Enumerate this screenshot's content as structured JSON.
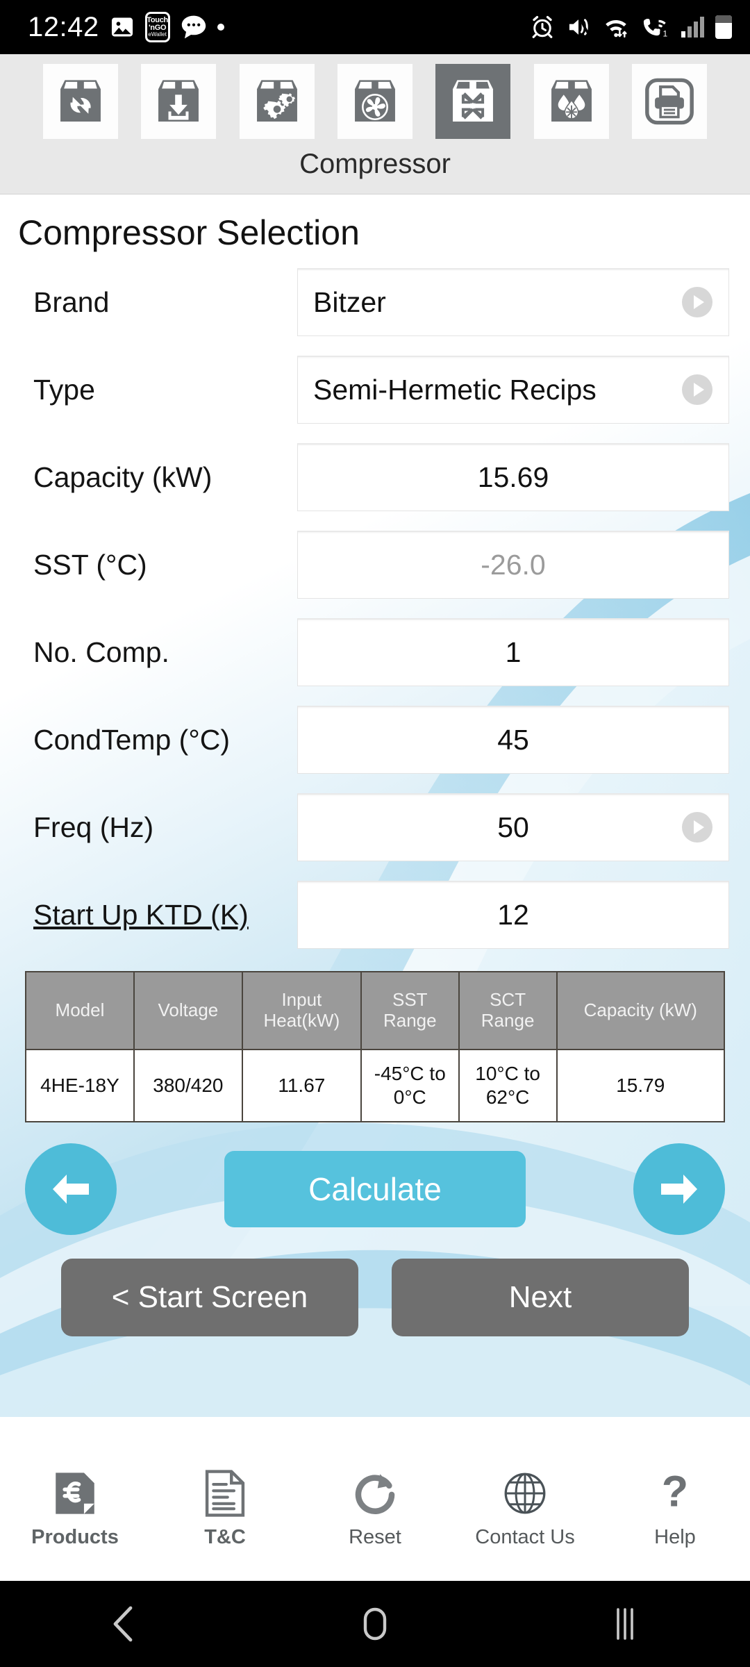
{
  "status_bar": {
    "time": "12:42",
    "left_icons": [
      "photos-icon",
      "touch-n-go-wallet-icon",
      "messages-icon",
      "notification-dot-icon"
    ],
    "wallet_badge": {
      "line1": "Touch",
      "line2": "'nGO",
      "line3": "eWallet"
    },
    "right_icons": [
      "alarm-icon",
      "mute-vibrate-icon",
      "wifi-icon",
      "wifi-calling-icon",
      "signal-bars-icon",
      "battery-icon"
    ]
  },
  "toolbar": {
    "title": "Compressor",
    "items": [
      {
        "name": "box-cycle-icon",
        "selected": false
      },
      {
        "name": "box-download-icon",
        "selected": false
      },
      {
        "name": "box-gears-icon",
        "selected": false
      },
      {
        "name": "box-fan-icon",
        "selected": false
      },
      {
        "name": "box-compress-icon",
        "selected": true
      },
      {
        "name": "box-droplets-icon",
        "selected": false
      },
      {
        "name": "printer-icon",
        "selected": false
      }
    ]
  },
  "page": {
    "title": "Compressor Selection"
  },
  "form": {
    "fields": [
      {
        "label": "Brand",
        "value": "Bitzer",
        "align": "left",
        "dropdown": true,
        "placeholder": false,
        "underline": false
      },
      {
        "label": "Type",
        "value": "Semi-Hermetic Recips",
        "align": "left",
        "dropdown": true,
        "placeholder": false,
        "underline": false
      },
      {
        "label": "Capacity (kW)",
        "value": "15.69",
        "align": "center",
        "dropdown": false,
        "placeholder": false,
        "underline": false
      },
      {
        "label": "SST (°C)",
        "value": "-26.0",
        "align": "center",
        "dropdown": false,
        "placeholder": true,
        "underline": false
      },
      {
        "label": "No. Comp.",
        "value": "1",
        "align": "center",
        "dropdown": false,
        "placeholder": false,
        "underline": false
      },
      {
        "label": "CondTemp (°C)",
        "value": "45",
        "align": "center",
        "dropdown": false,
        "placeholder": false,
        "underline": false
      },
      {
        "label": "Freq (Hz)",
        "value": "50",
        "align": "center",
        "dropdown": true,
        "placeholder": false,
        "underline": false
      },
      {
        "label": "Start Up KTD (K)",
        "value": "12",
        "align": "center",
        "dropdown": false,
        "placeholder": false,
        "underline": true
      }
    ]
  },
  "results_table": {
    "headers": [
      "Model",
      "Voltage",
      "Input Heat(kW)",
      "SST Range",
      "SCT Range",
      "Capacity (kW)"
    ],
    "headers_wrapped": [
      [
        "Model"
      ],
      [
        "Voltage"
      ],
      [
        "Input",
        "Heat(kW)"
      ],
      [
        "SST",
        "Range"
      ],
      [
        "SCT",
        "Range"
      ],
      [
        "Capacity (kW)"
      ]
    ],
    "rows": [
      {
        "model": "4HE-18Y",
        "voltage": "380/420",
        "input_heat_kw": "11.67",
        "sst_range_line1": "-45°C to",
        "sst_range_line2": "0°C",
        "sct_range_line1": "10°C to",
        "sct_range_line2": "62°C",
        "capacity_kw": "15.79"
      }
    ]
  },
  "actions": {
    "prev_label": "prev-arrow-icon",
    "calculate_label": "Calculate",
    "next_arrow_label": "next-arrow-icon",
    "start_screen_label": "< Start Screen",
    "next_label": "Next"
  },
  "tabbar": {
    "items": [
      {
        "label": "Products",
        "icon": "products-page-icon",
        "lit": true
      },
      {
        "label": "T&C",
        "icon": "document-icon",
        "lit": true
      },
      {
        "label": "Reset",
        "icon": "reset-circular-arrow-icon",
        "lit": false
      },
      {
        "label": "Contact Us",
        "icon": "globe-icon",
        "lit": false
      },
      {
        "label": "Help",
        "icon": "question-mark-icon",
        "lit": false
      }
    ]
  },
  "android_nav": {
    "items": [
      "back-icon",
      "home-icon",
      "recents-icon"
    ]
  },
  "colors": {
    "accent_cyan": "#56c2dd",
    "gray_button": "#6f6f6f",
    "toolbar_bg": "#e8e8e8",
    "table_header": "#9a9a9a",
    "icon_gray": "#6e7275"
  }
}
